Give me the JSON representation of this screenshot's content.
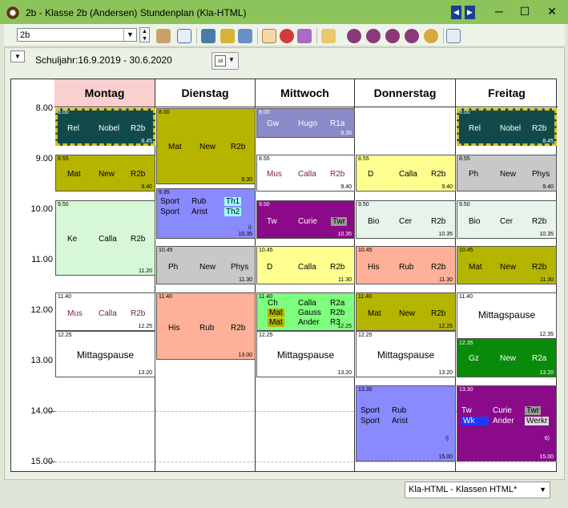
{
  "window": {
    "title": "2b - Klasse 2b (Andersen)  Stundenplan  (Kla-HTML)",
    "minimize": "─",
    "maximize": "☐",
    "close": "✕",
    "nav_prev": "◀",
    "nav_next": "▶"
  },
  "toolbar": {
    "class_value": "2b"
  },
  "header": {
    "schuljahr": "Schuljahr:16.9.2019 - 30.6.2020"
  },
  "days": [
    "Montag",
    "Dienstag",
    "Mittwoch",
    "Donnerstag",
    "Freitag"
  ],
  "hours": [
    "8.00",
    "9.00",
    "10.00",
    "11.00",
    "12.00",
    "13.00",
    "14.00",
    "15.00"
  ],
  "lessons": {
    "mo1": {
      "start": "8.00",
      "end": "8.45",
      "subject": "Rel",
      "teacher": "Nobel",
      "room": "R2b"
    },
    "mo2": {
      "start": "8.55",
      "end": "9.40",
      "subject": "Mat",
      "teacher": "New",
      "room": "R2b"
    },
    "mo3": {
      "start": "9.50",
      "end": "11.20",
      "subject": "Ke",
      "teacher": "Calla",
      "room": "R2b"
    },
    "mo4": {
      "start": "11.40",
      "end": "12.25",
      "subject": "Mus",
      "teacher": "Calla",
      "room": "R2b"
    },
    "mo5": {
      "start": "12.25",
      "end": "13.20",
      "text": "Mittagspause"
    },
    "di1": {
      "start": "8.00",
      "end": "9.30",
      "subject": "Mat",
      "teacher": "New",
      "room": "R2b"
    },
    "di2": {
      "start": "9.35",
      "end": "10.35",
      "s1": "Sport",
      "t1": "Rub",
      "r1": "Th1",
      "s2": "Sport",
      "t2": "Arist",
      "r2": "Th2",
      "note": "i)"
    },
    "di3": {
      "start": "10.45",
      "end": "11.30",
      "subject": "Ph",
      "teacher": "New",
      "room": "Phys"
    },
    "di4": {
      "start": "11.40",
      "end": "13.00",
      "subject": "His",
      "teacher": "Rub",
      "room": "R2b"
    },
    "mi1": {
      "start": "8.00",
      "end": "8.35",
      "subject": "Gw",
      "teacher": "Hugo",
      "room": "R1a"
    },
    "mi2": {
      "start": "8.55",
      "end": "9.40",
      "subject": "Mus",
      "teacher": "Calla",
      "room": "R2b"
    },
    "mi3": {
      "start": "9.50",
      "end": "10.35",
      "subject": "Tw",
      "teacher": "Curie",
      "room": "Twr"
    },
    "mi4": {
      "start": "10.45",
      "end": "11.30",
      "subject": "D",
      "teacher": "Calla",
      "room": "R2b"
    },
    "mi5": {
      "start": "11.40",
      "end": "12.25",
      "s1": "Ch",
      "t1": "Calla",
      "r1": "R2a",
      "s2": "Mat",
      "t2": "Gauss",
      "r2": "R2b",
      "s3": "Mat",
      "t3": "Ander",
      "r3": "R3"
    },
    "mi6": {
      "start": "12.25",
      "end": "13.20",
      "text": "Mittagspause"
    },
    "do1": {
      "start": "8.55",
      "end": "9.40",
      "subject": "D",
      "teacher": "Calla",
      "room": "R2b"
    },
    "do2": {
      "start": "9.50",
      "end": "10.35",
      "subject": "Bio",
      "teacher": "Cer",
      "room": "R2b"
    },
    "do3": {
      "start": "10.45",
      "end": "11.30",
      "subject": "His",
      "teacher": "Rub",
      "room": "R2b"
    },
    "do4": {
      "start": "11.40",
      "end": "12.25",
      "subject": "Mat",
      "teacher": "New",
      "room": "R2b"
    },
    "do5": {
      "start": "12.25",
      "end": "13.20",
      "text": "Mittagspause"
    },
    "do6": {
      "start": "13.30",
      "end": "15.00",
      "s1": "Sport",
      "t1": "Rub",
      "s2": "Sport",
      "t2": "Arist",
      "note": "i)"
    },
    "fr1": {
      "start": "8.00",
      "end": "8.45",
      "subject": "Rel",
      "teacher": "Nobel",
      "room": "R2b"
    },
    "fr2": {
      "start": "8.55",
      "end": "9.40",
      "subject": "Ph",
      "teacher": "New",
      "room": "Phys"
    },
    "fr3": {
      "start": "9.50",
      "end": "10.35",
      "subject": "Bio",
      "teacher": "Cer",
      "room": "R2b"
    },
    "fr4": {
      "start": "10.45",
      "end": "11.30",
      "subject": "Mat",
      "teacher": "New",
      "room": "R2b"
    },
    "fr5": {
      "start": "11.40",
      "end": "12.35",
      "text": "Mittagspause"
    },
    "fr6": {
      "start": "12.35",
      "end": "13.20",
      "subject": "Gz",
      "teacher": "New",
      "room": "R2a"
    },
    "fr7": {
      "start": "13.30",
      "end": "15.00",
      "s1": "Tw",
      "t1": "Curie",
      "r1": "Twr",
      "s2": "Wk",
      "t2": "Ander",
      "r2": "Werkr",
      "note": "6)"
    }
  },
  "status": {
    "view": "Kla-HTML - Klassen HTML*"
  }
}
